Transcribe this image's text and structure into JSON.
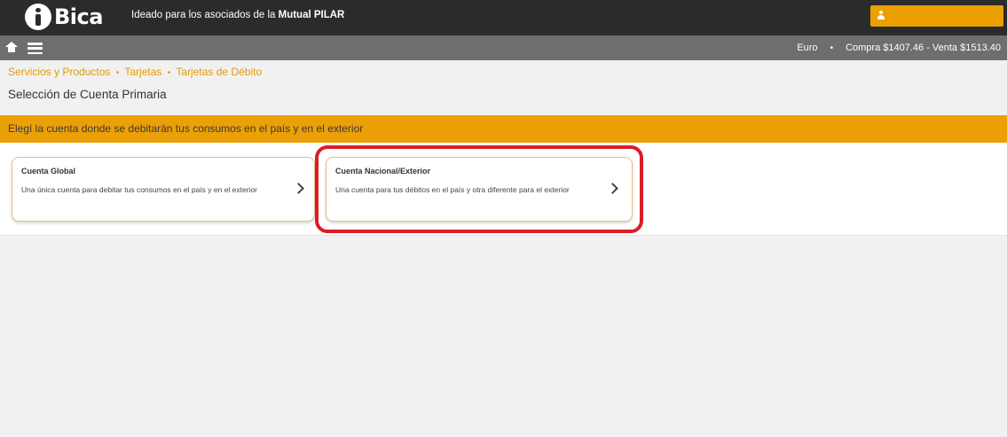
{
  "header": {
    "brand": "Bica",
    "tagline_prefix": "Ideado para los asociados de la",
    "tagline_bold": "Mutual PILAR",
    "user_name": "",
    "colors": {
      "topbar": "#2b2b2b",
      "accent": "#eaa000"
    }
  },
  "navbar": {
    "home_icon": "home-icon",
    "menu_icon": "menu-icon",
    "currency_label": "Euro",
    "separator": "•",
    "rates": "Compra $1407.46 - Venta $1513.40",
    "colors": {
      "background": "#6e6e6e"
    }
  },
  "breadcrumb": {
    "items": [
      "Servicios y Productos",
      "Tarjetas",
      "Tarjetas de Débito"
    ],
    "separator": "•"
  },
  "page": {
    "title": "Selección de Cuenta Primaria"
  },
  "banner": {
    "text": "Elegí la cuenta donde se debitarán tus consumos en el país y en el exterior",
    "color": "#eba008"
  },
  "options": [
    {
      "title": "Cuenta Global",
      "description": "Una única cuenta para debitar tus consumos en el país y en el exterior",
      "icon": "chevron-right-icon"
    },
    {
      "title": "Cuenta Nacional/Exterior",
      "description": "Una cuenta para tus débitos en el país y otra diferente para el exterior",
      "icon": "chevron-right-icon",
      "highlighted": true,
      "highlight_color": "#d91d26"
    }
  ]
}
